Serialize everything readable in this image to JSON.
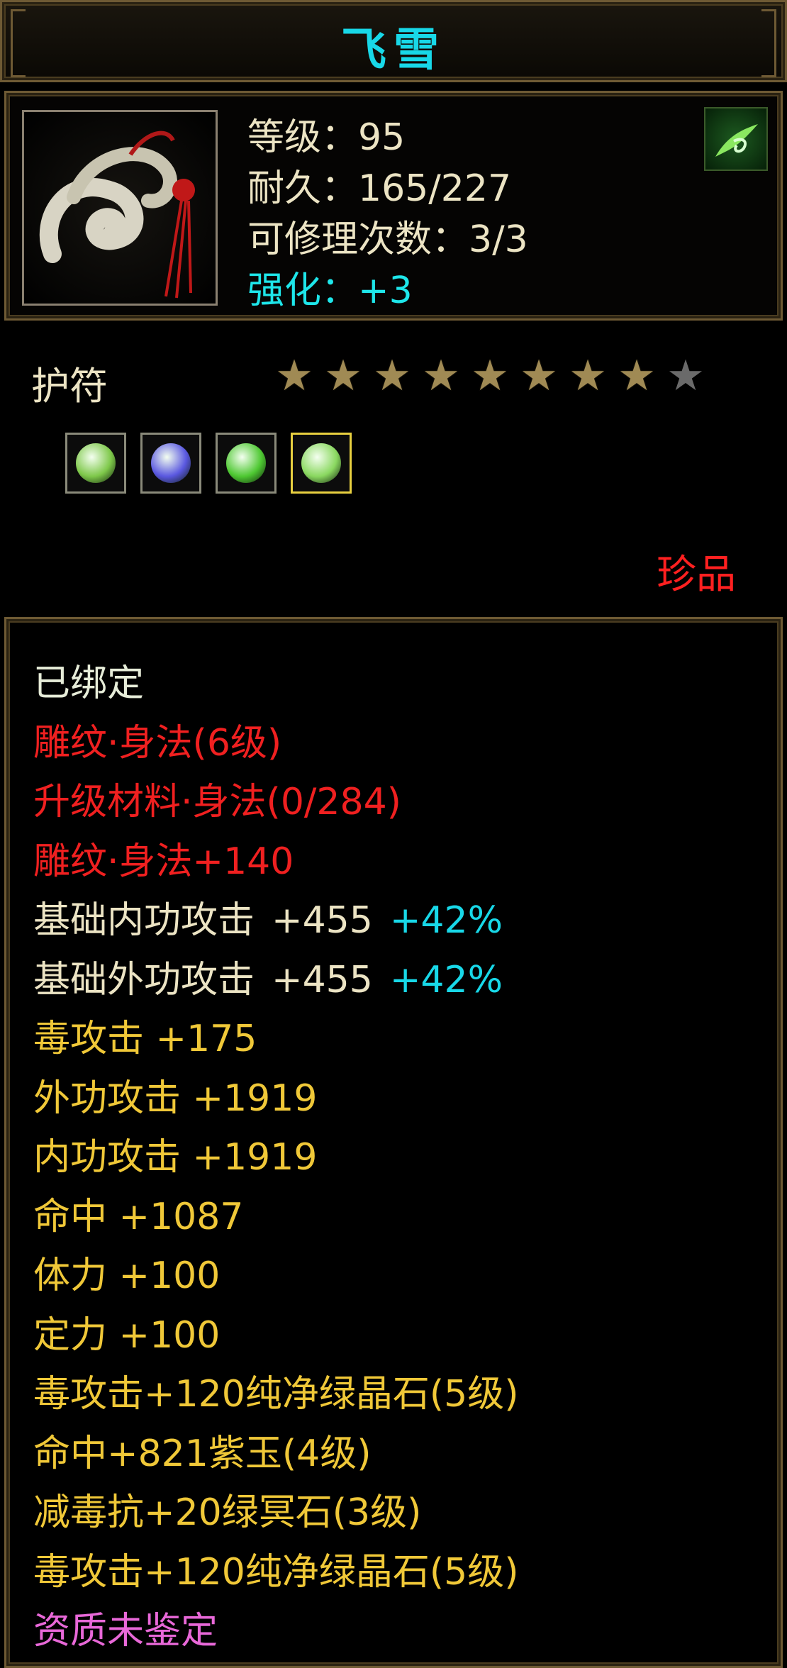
{
  "title": "飞雪",
  "stats": {
    "level": "等级：95",
    "durability": "耐久：165/227",
    "repair": "可修理次数：3/3",
    "enhance": "强化：+3"
  },
  "category": "护符",
  "stars": {
    "filled": 8,
    "total": 9
  },
  "gems": [
    {
      "name": "green-white-gem",
      "color": "#7ec84a"
    },
    {
      "name": "blue-purple-gem",
      "color": "#5a58e0"
    },
    {
      "name": "green-crystal-gem",
      "color": "#4ec832"
    },
    {
      "name": "green-white-gem",
      "color": "#8ad860"
    }
  ],
  "rarity": "珍品",
  "details": {
    "bound": "已绑定",
    "carve_level": "雕纹·身法(6级)",
    "upgrade_material": "升级材料·身法(0/284)",
    "carve_bonus": "雕纹·身法+140",
    "base_inner_attack": {
      "label": "基础内功攻击",
      "value": "+455",
      "pct": "+42%"
    },
    "base_outer_attack": {
      "label": "基础外功攻击",
      "value": "+455",
      "pct": "+42%"
    },
    "poison_attack": "毒攻击 +175",
    "outer_attack": "外功攻击 +1919",
    "inner_attack": "内功攻击 +1919",
    "hit": "命中 +1087",
    "stamina": "体力 +100",
    "focus": "定力 +100",
    "gem_line_1": "毒攻击+120纯净绿晶石(5级)",
    "gem_line_2": "命中+821紫玉(4级)",
    "gem_line_3": "减毒抗+20绿冥石(3级)",
    "gem_line_4": "毒攻击+120纯净绿晶石(5级)",
    "quality": "资质未鉴定"
  },
  "colors": {
    "title": "#18d8e8",
    "enhance": "#1ee6ea",
    "rarity": "#ff2020",
    "carve": "#f02020",
    "attribute": "#f0c838",
    "quality": "#e868d8"
  }
}
